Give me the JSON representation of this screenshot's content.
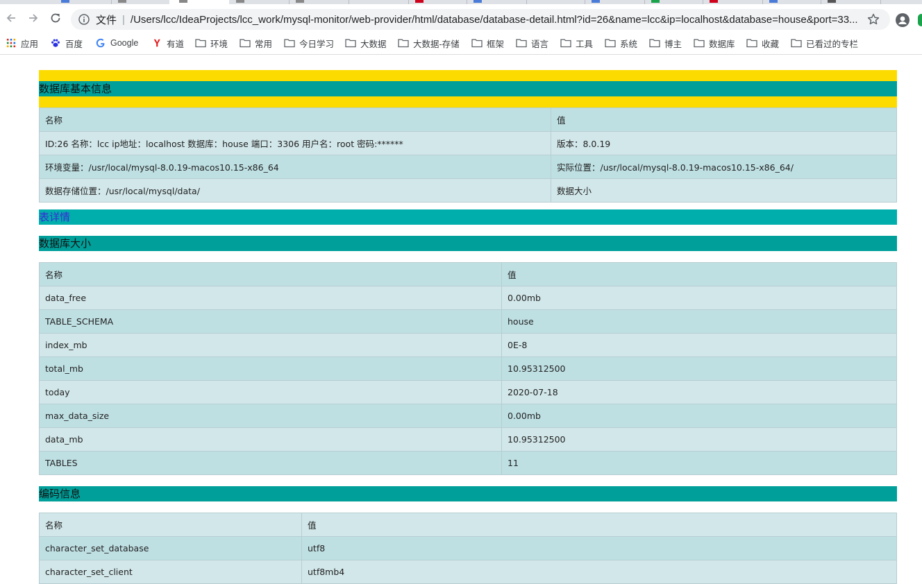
{
  "browser": {
    "scheme_label": "文件",
    "url": "/Users/lcc/IdeaProjects/lcc_work/mysql-monitor/web-provider/html/database/database-detail.html?id=26&name=lcc&ip=localhost&database=house&port=33...",
    "bookmarks": [
      {
        "label": "应用",
        "icon": "apps-grid-icon"
      },
      {
        "label": "百度",
        "icon": "baidu-paw-icon"
      },
      {
        "label": "Google",
        "icon": "google-g-icon"
      },
      {
        "label": "有道",
        "icon": "youdao-icon"
      },
      {
        "label": "环境",
        "icon": "folder-icon"
      },
      {
        "label": "常用",
        "icon": "folder-icon"
      },
      {
        "label": "今日学习",
        "icon": "folder-icon"
      },
      {
        "label": "大数据",
        "icon": "folder-icon"
      },
      {
        "label": "大数据-存储",
        "icon": "folder-icon"
      },
      {
        "label": "框架",
        "icon": "folder-icon"
      },
      {
        "label": "语言",
        "icon": "folder-icon"
      },
      {
        "label": "工具",
        "icon": "folder-icon"
      },
      {
        "label": "系统",
        "icon": "folder-icon"
      },
      {
        "label": "博主",
        "icon": "folder-icon"
      },
      {
        "label": "数据库",
        "icon": "folder-icon"
      },
      {
        "label": "收藏",
        "icon": "folder-icon"
      },
      {
        "label": "已看过的专栏",
        "icon": "folder-icon"
      }
    ]
  },
  "basic_info": {
    "title": "数据库基本信息",
    "header": {
      "name": "名称",
      "value": "值"
    },
    "rows": [
      {
        "name": "ID:26 名称：lcc ip地址：localhost 数据库：house 端口：3306 用户名：root 密码:******",
        "value": "版本：8.0.19"
      },
      {
        "name": "环境变量：/usr/local/mysql-8.0.19-macos10.15-x86_64",
        "value": "实际位置：/usr/local/mysql-8.0.19-macos10.15-x86_64/"
      },
      {
        "name": "数据存储位置：/usr/local/mysql/data/",
        "value": "数据大小"
      }
    ]
  },
  "table_detail_link": "表详情",
  "db_size": {
    "title": "数据库大小",
    "header": {
      "name": "名称",
      "value": "值"
    },
    "rows": [
      {
        "name": "data_free",
        "value": "0.00mb"
      },
      {
        "name": "TABLE_SCHEMA",
        "value": "house"
      },
      {
        "name": "index_mb",
        "value": "0E-8"
      },
      {
        "name": "total_mb",
        "value": "10.95312500"
      },
      {
        "name": "today",
        "value": "2020-07-18"
      },
      {
        "name": "max_data_size",
        "value": "0.00mb"
      },
      {
        "name": "data_mb",
        "value": "10.95312500"
      },
      {
        "name": "TABLES",
        "value": "11"
      }
    ]
  },
  "encoding": {
    "title": "编码信息",
    "header": {
      "name": "名称",
      "value": "值"
    },
    "rows": [
      {
        "name": "character_set_database",
        "value": "utf8"
      },
      {
        "name": "character_set_client",
        "value": "utf8mb4"
      }
    ]
  },
  "colors": {
    "yellow": "#fcdc00",
    "teal": "#009f9a",
    "link_bar": "#00aeac",
    "link_text": "#3b2bd6",
    "row_dark": "#bfe0e3",
    "row_light": "#d2e7ea"
  }
}
